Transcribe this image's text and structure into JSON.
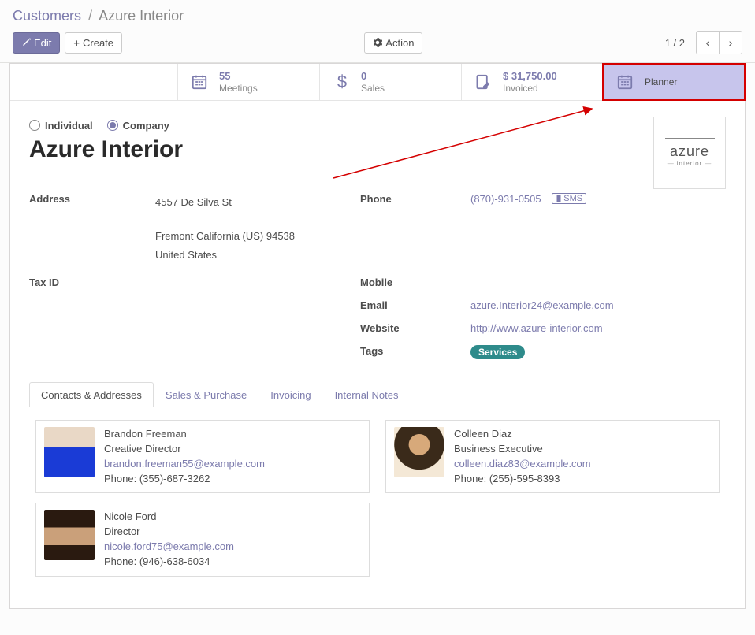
{
  "breadcrumb": {
    "parent": "Customers",
    "current": "Azure Interior"
  },
  "toolbar": {
    "edit": "Edit",
    "create": "Create",
    "action": "Action",
    "pager": "1 / 2"
  },
  "stat": {
    "meetings": {
      "value": "55",
      "label": "Meetings"
    },
    "sales": {
      "value": "0",
      "label": "Sales"
    },
    "invoiced": {
      "value": "$ 31,750.00",
      "label": "Invoiced"
    },
    "planner": {
      "label": "Planner"
    }
  },
  "type": {
    "individual": "Individual",
    "company": "Company",
    "selected": "company"
  },
  "name": "Azure Interior",
  "logo": {
    "brand": "azure",
    "sub": "interior"
  },
  "fields": {
    "address_label": "Address",
    "address": {
      "street": "4557 De Silva St",
      "city_line": "Fremont California (US)  94538",
      "country": "United States"
    },
    "tax_id_label": "Tax ID",
    "tax_id": "",
    "phone_label": "Phone",
    "phone": "(870)-931-0505",
    "sms": "SMS",
    "mobile_label": "Mobile",
    "mobile": "",
    "email_label": "Email",
    "email": "azure.Interior24@example.com",
    "website_label": "Website",
    "website": "http://www.azure-interior.com",
    "tags_label": "Tags",
    "tags": [
      "Services"
    ]
  },
  "tabs": {
    "items": [
      {
        "label": "Contacts & Addresses",
        "active": true
      },
      {
        "label": "Sales & Purchase",
        "active": false
      },
      {
        "label": "Invoicing",
        "active": false
      },
      {
        "label": "Internal Notes",
        "active": false
      }
    ]
  },
  "contacts": [
    {
      "name": "Brandon Freeman",
      "title": "Creative Director",
      "email": "brandon.freeman55@example.com",
      "phone": "Phone: (355)-687-3262"
    },
    {
      "name": "Colleen Diaz",
      "title": "Business Executive",
      "email": "colleen.diaz83@example.com",
      "phone": "Phone: (255)-595-8393"
    },
    {
      "name": "Nicole Ford",
      "title": "Director",
      "email": "nicole.ford75@example.com",
      "phone": "Phone: (946)-638-6034"
    }
  ]
}
